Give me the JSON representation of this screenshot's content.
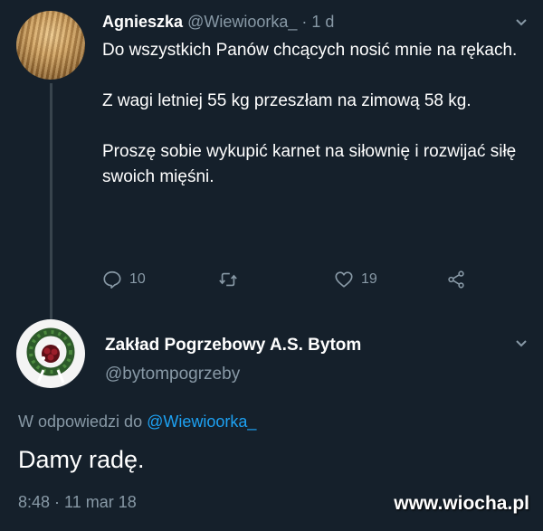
{
  "tweet": {
    "author_name": "Agnieszka",
    "author_handle": "@Wiewioorka_",
    "separator": "·",
    "time": "1 d",
    "paragraphs": [
      "Do wszystkich Panów chcących nosić mnie na rękach.",
      "Z wagi letniej 55 kg przeszłam na zimową 58 kg.",
      "Proszę sobie wykupić karnet na siłownię i rozwijać siłę swoich mięśni."
    ],
    "actions": {
      "reply_icon": "reply-icon",
      "reply_count": "10",
      "retweet_icon": "retweet-icon",
      "like_icon": "heart-icon",
      "like_count": "19",
      "share_icon": "share-icon"
    }
  },
  "reply": {
    "author_name": "Zakład Pogrzebowy A.S. Bytom",
    "author_handle": "@bytompogrzeby",
    "replying_to_prefix": "W odpowiedzi do",
    "replying_to_handle": "@Wiewioorka_",
    "text": "Damy radę.",
    "timestamp": "8:48 · 11 mar 18"
  },
  "watermark": "www.wiocha.pl",
  "colors": {
    "background": "#15202b",
    "text_primary": "#ffffff",
    "text_secondary": "#8899a6",
    "link": "#1da1f2"
  }
}
